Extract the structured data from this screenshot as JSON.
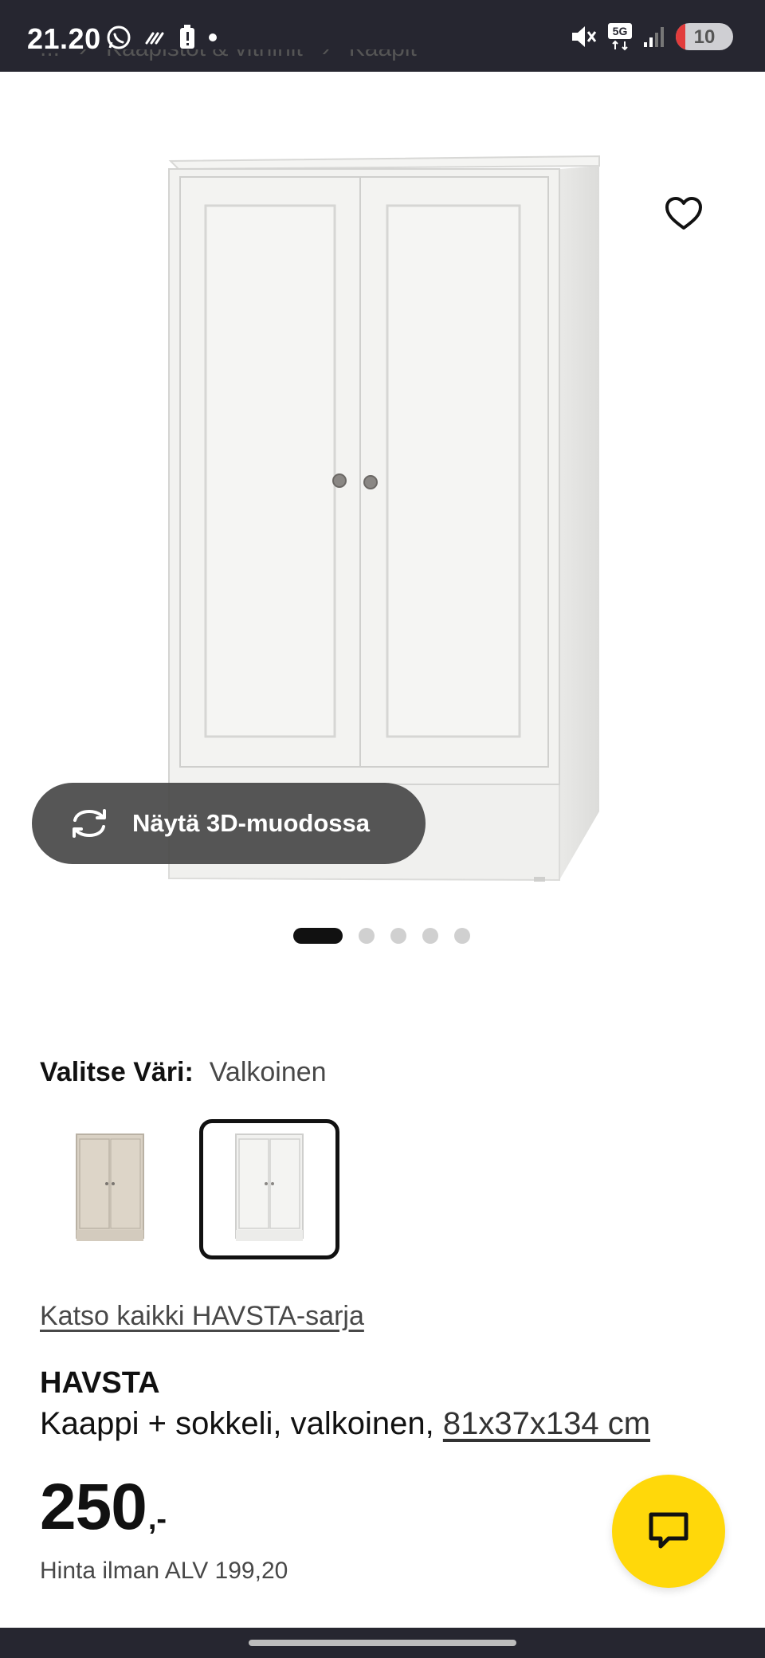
{
  "status_bar": {
    "time": "21.20",
    "network": "5G",
    "battery": "10"
  },
  "breadcrumb": {
    "items": [
      "...",
      "Kaapistot & vitriinit",
      "Kaapit"
    ]
  },
  "product_image": {
    "view_3d_label": "Näytä 3D-muodossa",
    "gallery_count": 5,
    "gallery_active_index": 0
  },
  "color_picker": {
    "title": "Valitse Väri:",
    "selected_value": "Valkoinen",
    "swatch_colors": [
      "#d7cfc2",
      "#f1f1ef"
    ]
  },
  "series_link": "Katso kaikki HAVSTA-sarja",
  "product": {
    "brand": "HAVSTA",
    "description": "Kaappi + sokkeli, valkoinen, ",
    "size": "81x37x134 cm",
    "price_main": "250",
    "price_suffix": ",-",
    "vat_text": "Hinta ilman ALV 199,20"
  },
  "colors": {
    "accent_yellow": "#ffd80a",
    "status_bar_bg": "#262630"
  }
}
